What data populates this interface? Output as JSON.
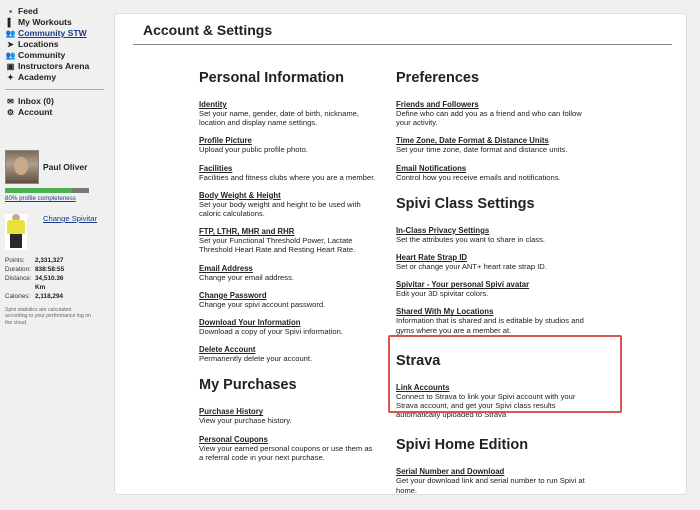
{
  "sidebar": {
    "nav": [
      {
        "label": "Feed",
        "icon": "feed-icon",
        "glyph": "▪"
      },
      {
        "label": "My Workouts",
        "icon": "workouts-icon",
        "glyph": "▌"
      },
      {
        "label": "Community STW",
        "icon": "community-group-icon",
        "glyph": "👥"
      },
      {
        "label": "Locations",
        "icon": "location-arrow-icon",
        "glyph": "➤"
      },
      {
        "label": "Community",
        "icon": "community-icon",
        "glyph": "👥"
      },
      {
        "label": "Instructors Arena",
        "icon": "instructors-icon",
        "glyph": "▣"
      },
      {
        "label": "Academy",
        "icon": "academy-icon",
        "glyph": "✦"
      }
    ],
    "nav2": [
      {
        "label": "Inbox (0)",
        "icon": "inbox-icon",
        "glyph": "✉"
      },
      {
        "label": "Account",
        "icon": "gear-icon",
        "glyph": "⚙"
      }
    ],
    "profile": {
      "name": "Paul Oliver",
      "completeness_label": "80% profile completeness",
      "completeness": 0.8,
      "change_spivitar": "Change Spivitar",
      "stats": [
        {
          "k": "Points:",
          "v": "2,331,327"
        },
        {
          "k": "Duration:",
          "v": "838:58:55"
        },
        {
          "k": "Distance:",
          "v": "34,510.36 Km"
        },
        {
          "k": "Calories:",
          "v": "2,118,294"
        }
      ],
      "note": "Spivi statistics are calculated according to your performance log on the cloud."
    }
  },
  "page": {
    "title": "Account & Settings",
    "left": {
      "personal": {
        "heading": "Personal Information",
        "items": [
          {
            "t": "Identity",
            "d": "Set your name, gender, date of birth, nickname, location and display name settings."
          },
          {
            "t": "Profile Picture",
            "d": "Upload your public profile photo."
          },
          {
            "t": "Facilities",
            "d": "Facilities and fitness clubs where you are a member."
          },
          {
            "t": "Body Weight & Height",
            "d": "Set your body weight and height to be used with caloric calculations."
          },
          {
            "t": "FTP, LTHR, MHR and RHR",
            "d": "Set your Functional Threshold Power, Lactate Threshold Heart Rate and Resting Heart Rate."
          },
          {
            "t": "Email Address",
            "d": "Change your email address."
          },
          {
            "t": "Change Password",
            "d": "Change your spivi account password."
          },
          {
            "t": "Download Your Information",
            "d": "Download a copy of your Spivi information."
          },
          {
            "t": "Delete Account",
            "d": "Permanently delete your account."
          }
        ]
      },
      "purchases": {
        "heading": "My Purchases",
        "items": [
          {
            "t": "Purchase History",
            "d": "View your purchase history."
          },
          {
            "t": "Personal Coupons",
            "d": "View your earned personal coupons or use them as a referral code in your next purchase."
          }
        ]
      }
    },
    "right": {
      "preferences": {
        "heading": "Preferences",
        "items": [
          {
            "t": "Friends and Followers",
            "d": "Define who can add you as a friend and who can follow your activity."
          },
          {
            "t": "Time Zone, Date Format & Distance Units",
            "d": "Set your time zone, date format and distance units."
          },
          {
            "t": "Email Notifications",
            "d": "Control how you receive emails and notifications."
          }
        ]
      },
      "class": {
        "heading": "Spivi Class Settings",
        "items": [
          {
            "t": "In-Class Privacy Settings",
            "d": "Set the attributes you want to share in class."
          },
          {
            "t": "Heart Rate Strap ID",
            "d": "Set or change your ANT+ heart rate strap ID."
          },
          {
            "t": "Spivitar",
            "t2": " - Your personal Spivi avatar",
            "d": "Edit your 3D spivitar colors."
          },
          {
            "t": "Shared With My Locations",
            "d": "Information that is shared and is editable by studios and gyms where you are a member at."
          }
        ]
      },
      "strava": {
        "heading": "Strava",
        "items": [
          {
            "t": "Link Accounts",
            "d": "Connect to Strava to link your Spivi account with your Strava account, and get your Spivi class results automatically uploaded to Strava"
          }
        ]
      },
      "home": {
        "heading": "Spivi Home Edition",
        "items": [
          {
            "t": "Serial Number and Download",
            "d": "Get your download link and serial number to run Spivi at home."
          }
        ]
      }
    }
  },
  "colors": {
    "highlight": "#d9534f",
    "progress": "#4caf50",
    "link": "#1a3a8a"
  }
}
